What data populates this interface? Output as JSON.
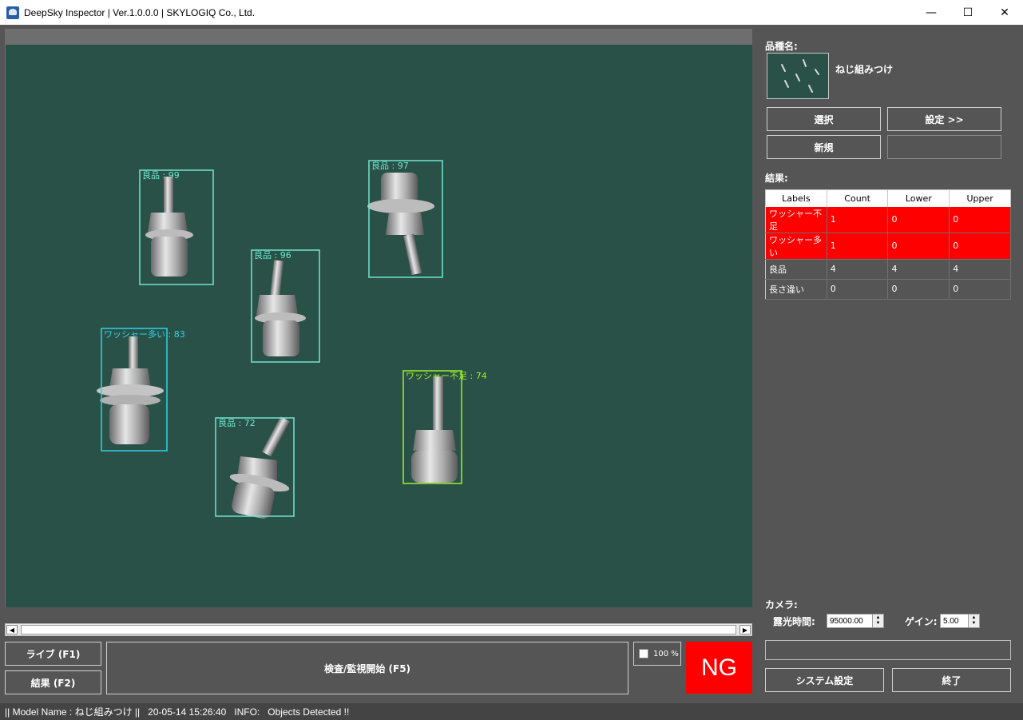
{
  "window": {
    "title": "DeepSky Inspector | Ver.1.0.0.0 | SKYLOGIQ Co., Ltd.",
    "icon": "app-logo-icon",
    "controls": [
      "minimize-icon",
      "maximize-icon",
      "close-icon"
    ]
  },
  "viewer": {
    "detections": [
      {
        "label": "良品 : 99",
        "color": "#6fe6cf"
      },
      {
        "label": "良品 : 97",
        "color": "#6fe6cf"
      },
      {
        "label": "良品 : 96",
        "color": "#6fe6cf"
      },
      {
        "label": "ワッシャー多い : 83",
        "color": "#2fd4e6"
      },
      {
        "label": "ワッシャー不足 : 74",
        "color": "#9ef02a"
      },
      {
        "label": "良品 : 72",
        "color": "#6fe6cf"
      }
    ]
  },
  "bottom": {
    "live_button": "ライブ (F1)",
    "result_button": "結果 (F2)",
    "inspect_button": "検査/監視開始 (F5)",
    "zoom_label": "100 %",
    "verdict": "NG"
  },
  "right": {
    "product_label": "品種名:",
    "product_name": "ねじ組みつけ",
    "select_button": "選択",
    "settings_button": "設定 >>",
    "new_button": "新規",
    "result_label": "結果:",
    "table": {
      "headers": [
        "Labels",
        "Count",
        "Lower",
        "Upper"
      ],
      "rows": [
        {
          "label": "ワッシャー不足",
          "count": "1",
          "lower": "0",
          "upper": "0",
          "status": "ng"
        },
        {
          "label": "ワッシャー多い",
          "count": "1",
          "lower": "0",
          "upper": "0",
          "status": "ng"
        },
        {
          "label": "良品",
          "count": "4",
          "lower": "4",
          "upper": "4",
          "status": "ok"
        },
        {
          "label": "長さ違い",
          "count": "0",
          "lower": "0",
          "upper": "0",
          "status": "ok"
        }
      ]
    },
    "camera_label": "カメラ:",
    "exposure_label": "露光時間:",
    "exposure_value": "95000.00",
    "gain_label": "ゲイン:",
    "gain_value": "5.00",
    "system_button": "システム設定",
    "exit_button": "終了"
  },
  "status": {
    "model": "|| Model Name : ねじ組みつけ ||",
    "timestamp": "20-05-14 15:26:40",
    "info_label": "INFO:",
    "message": "Objects Detected !!"
  },
  "colors": {
    "ng": "#ff0000",
    "background": "#555555",
    "board": "#2a5148"
  }
}
